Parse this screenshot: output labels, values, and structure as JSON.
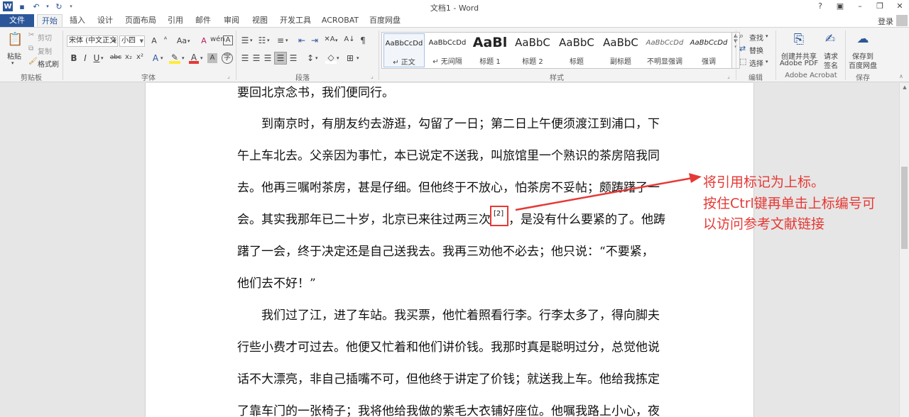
{
  "window": {
    "title": "文档1 - Word",
    "help": "?",
    "login": "登录"
  },
  "tabs": [
    "文件",
    "开始",
    "插入",
    "设计",
    "页面布局",
    "引用",
    "邮件",
    "审阅",
    "视图",
    "开发工具",
    "ACROBAT",
    "百度网盘"
  ],
  "ribbon": {
    "clipboard": {
      "label": "剪贴板",
      "paste": "粘贴",
      "cut": "剪切",
      "copy": "复制",
      "format_painter": "格式刷"
    },
    "font": {
      "label": "字体",
      "font_name": "宋体 (中文正文)",
      "font_size": "小四",
      "bold": "B",
      "italic": "I",
      "underline": "U",
      "strike": "abc",
      "subscript": "x₂",
      "superscript": "x²",
      "grow": "A",
      "case": "Aa",
      "clear": "A",
      "wen": "wén",
      "char_border": "A"
    },
    "paragraph": {
      "label": "段落"
    },
    "styles": {
      "label": "样式",
      "items": [
        {
          "sample": "AaBbCcDd",
          "name": "↵ 正文"
        },
        {
          "sample": "AaBbCcDd",
          "name": "↵ 无间隔"
        },
        {
          "sample": "AaBl",
          "name": "标题 1"
        },
        {
          "sample": "AaBbC",
          "name": "标题 2"
        },
        {
          "sample": "AaBbC",
          "name": "标题"
        },
        {
          "sample": "AaBbC",
          "name": "副标题"
        },
        {
          "sample": "AaBbCcDd",
          "name": "不明显强调"
        },
        {
          "sample": "AaBbCcDd",
          "name": "强调"
        }
      ]
    },
    "editing": {
      "label": "编辑",
      "find": "查找",
      "replace": "替换",
      "select": "选择"
    },
    "acrobat": {
      "label": "Adobe Acrobat",
      "create_line1": "创建并共享",
      "create_line2": "Adobe PDF",
      "sign_line1": "请求",
      "sign_line2": "签名"
    },
    "save": {
      "label": "保存",
      "line1": "保存到",
      "line2": "百度网盘"
    }
  },
  "document": {
    "lines": [
      "要回北京念书，我们便同行。",
      "到南京时，有朋友约去游逛，勾留了一日；第二日上午便须渡江到浦口，下",
      "午上车北去。父亲因为事忙，本已说定不送我，叫旅馆里一个熟识的茶房陪我同",
      "去。他再三嘱咐茶房，甚是仔细。但他终于不放心，怕茶房不妥帖；颇踌躇了一",
      "会。其实我那年已二十岁，北京已来往过两三次",
      "，是没有什么要紧的了。他踌",
      "躇了一会，终于决定还是自己送我去。我再三劝他不必去；他只说：“不要紧，",
      "他们去不好！”",
      "我们过了江，进了车站。我买票，他忙着照看行李。行李太多了，得向脚夫",
      "行些小费才可过去。他便又忙着和他们讲价钱。我那时真是聪明过分，总觉他说",
      "话不大漂亮，非自己插嘴不可，但他终于讲定了价钱；就送我上车。他给我拣定",
      "了靠车门的一张椅子；我将他给我做的紫毛大衣铺好座位。他嘱我路上小心，夜"
    ],
    "citation": "[2]"
  },
  "annotation": {
    "line1": "将引用标记为上标。",
    "line2": "按住Ctrl键再单击上标编号可",
    "line3": "以访问参考文献链接",
    "color": "#e53935"
  },
  "colors": {
    "accent": "#2b579a",
    "annotation": "#e53935"
  }
}
